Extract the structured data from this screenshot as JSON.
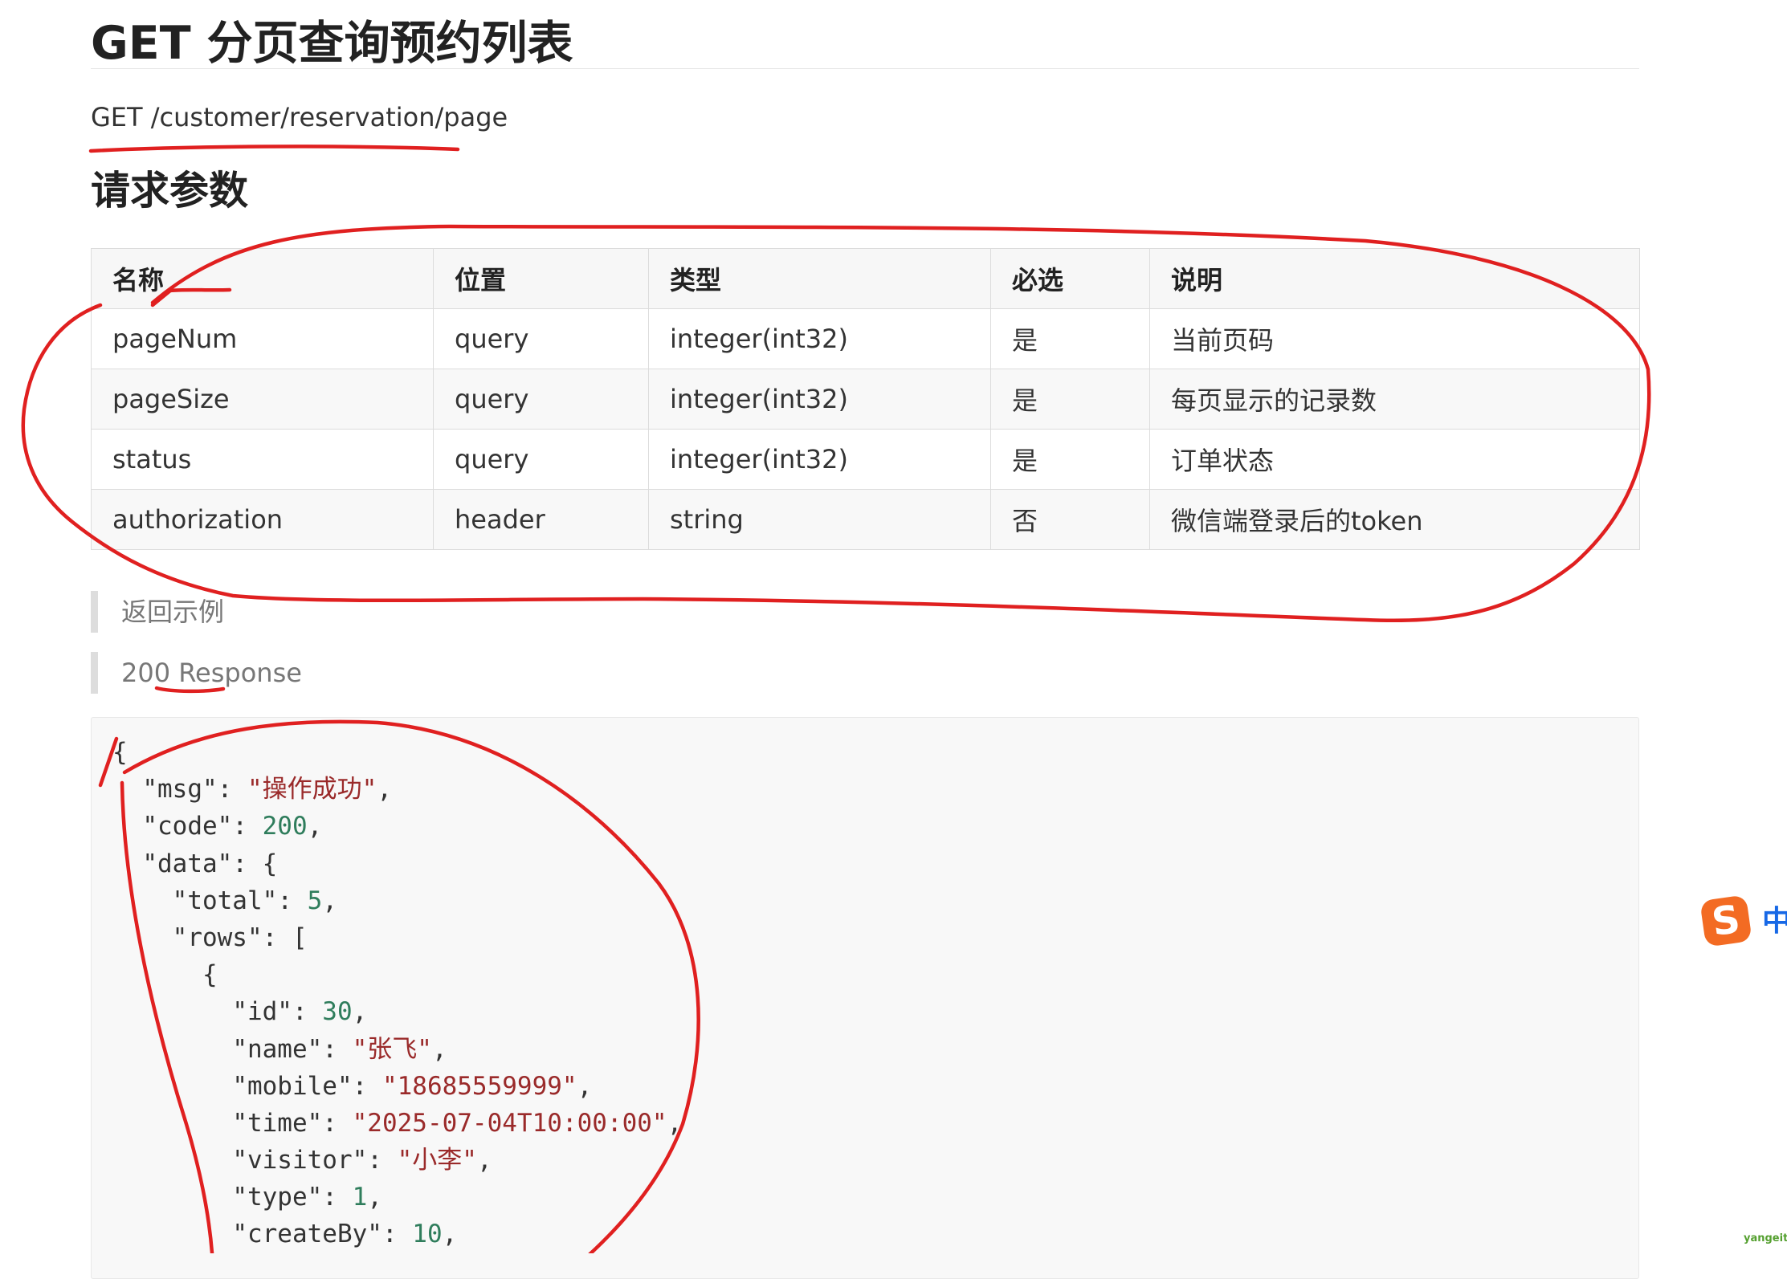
{
  "title": "GET 分页查询预约列表",
  "endpoint": "GET /customer/reservation/page",
  "params_section": {
    "title": "请求参数",
    "columns": [
      "名称",
      "位置",
      "类型",
      "必选",
      "说明"
    ],
    "rows": [
      [
        "pageNum",
        "query",
        "integer(int32)",
        "是",
        "当前页码"
      ],
      [
        "pageSize",
        "query",
        "integer(int32)",
        "是",
        "每页显示的记录数"
      ],
      [
        "status",
        "query",
        "integer(int32)",
        "是",
        "订单状态"
      ],
      [
        "authorization",
        "header",
        "string",
        "否",
        "微信端登录后的token"
      ]
    ]
  },
  "response_section": {
    "example_label": "返回示例",
    "status_label": "200 Response"
  },
  "code_lines": [
    [
      {
        "t": "{",
        "k": "punc"
      }
    ],
    [
      {
        "t": "  ",
        "k": "punc"
      },
      {
        "t": "\"msg\"",
        "k": "key"
      },
      {
        "t": ": ",
        "k": "punc"
      },
      {
        "t": "\"操作成功\"",
        "k": "str"
      },
      {
        "t": ",",
        "k": "punc"
      }
    ],
    [
      {
        "t": "  ",
        "k": "punc"
      },
      {
        "t": "\"code\"",
        "k": "key"
      },
      {
        "t": ": ",
        "k": "punc"
      },
      {
        "t": "200",
        "k": "num"
      },
      {
        "t": ",",
        "k": "punc"
      }
    ],
    [
      {
        "t": "  ",
        "k": "punc"
      },
      {
        "t": "\"data\"",
        "k": "key"
      },
      {
        "t": ": {",
        "k": "punc"
      }
    ],
    [
      {
        "t": "    ",
        "k": "punc"
      },
      {
        "t": "\"total\"",
        "k": "key"
      },
      {
        "t": ": ",
        "k": "punc"
      },
      {
        "t": "5",
        "k": "num"
      },
      {
        "t": ",",
        "k": "punc"
      }
    ],
    [
      {
        "t": "    ",
        "k": "punc"
      },
      {
        "t": "\"rows\"",
        "k": "key"
      },
      {
        "t": ": [",
        "k": "punc"
      }
    ],
    [
      {
        "t": "      {",
        "k": "punc"
      }
    ],
    [
      {
        "t": "        ",
        "k": "punc"
      },
      {
        "t": "\"id\"",
        "k": "key"
      },
      {
        "t": ": ",
        "k": "punc"
      },
      {
        "t": "30",
        "k": "num"
      },
      {
        "t": ",",
        "k": "punc"
      }
    ],
    [
      {
        "t": "        ",
        "k": "punc"
      },
      {
        "t": "\"name\"",
        "k": "key"
      },
      {
        "t": ": ",
        "k": "punc"
      },
      {
        "t": "\"张飞\"",
        "k": "str"
      },
      {
        "t": ",",
        "k": "punc"
      }
    ],
    [
      {
        "t": "        ",
        "k": "punc"
      },
      {
        "t": "\"mobile\"",
        "k": "key"
      },
      {
        "t": ": ",
        "k": "punc"
      },
      {
        "t": "\"18685559999\"",
        "k": "str"
      },
      {
        "t": ",",
        "k": "punc"
      }
    ],
    [
      {
        "t": "        ",
        "k": "punc"
      },
      {
        "t": "\"time\"",
        "k": "key"
      },
      {
        "t": ": ",
        "k": "punc"
      },
      {
        "t": "\"2025-07-04T10:00:00\"",
        "k": "str"
      },
      {
        "t": ",",
        "k": "punc"
      }
    ],
    [
      {
        "t": "        ",
        "k": "punc"
      },
      {
        "t": "\"visitor\"",
        "k": "key"
      },
      {
        "t": ": ",
        "k": "punc"
      },
      {
        "t": "\"小李\"",
        "k": "str"
      },
      {
        "t": ",",
        "k": "punc"
      }
    ],
    [
      {
        "t": "        ",
        "k": "punc"
      },
      {
        "t": "\"type\"",
        "k": "key"
      },
      {
        "t": ": ",
        "k": "punc"
      },
      {
        "t": "1",
        "k": "num"
      },
      {
        "t": ",",
        "k": "punc"
      }
    ],
    [
      {
        "t": "        ",
        "k": "punc"
      },
      {
        "t": "\"createBy\"",
        "k": "key"
      },
      {
        "t": ": ",
        "k": "punc"
      },
      {
        "t": "10",
        "k": "num"
      },
      {
        "t": ",",
        "k": "punc"
      }
    ]
  ],
  "ime": {
    "logo": "S",
    "mode": "中"
  },
  "watermark": "yangeit",
  "colors": {
    "annotation": "#e02020",
    "string": "#9a2a2a",
    "number": "#2f7d5c"
  }
}
